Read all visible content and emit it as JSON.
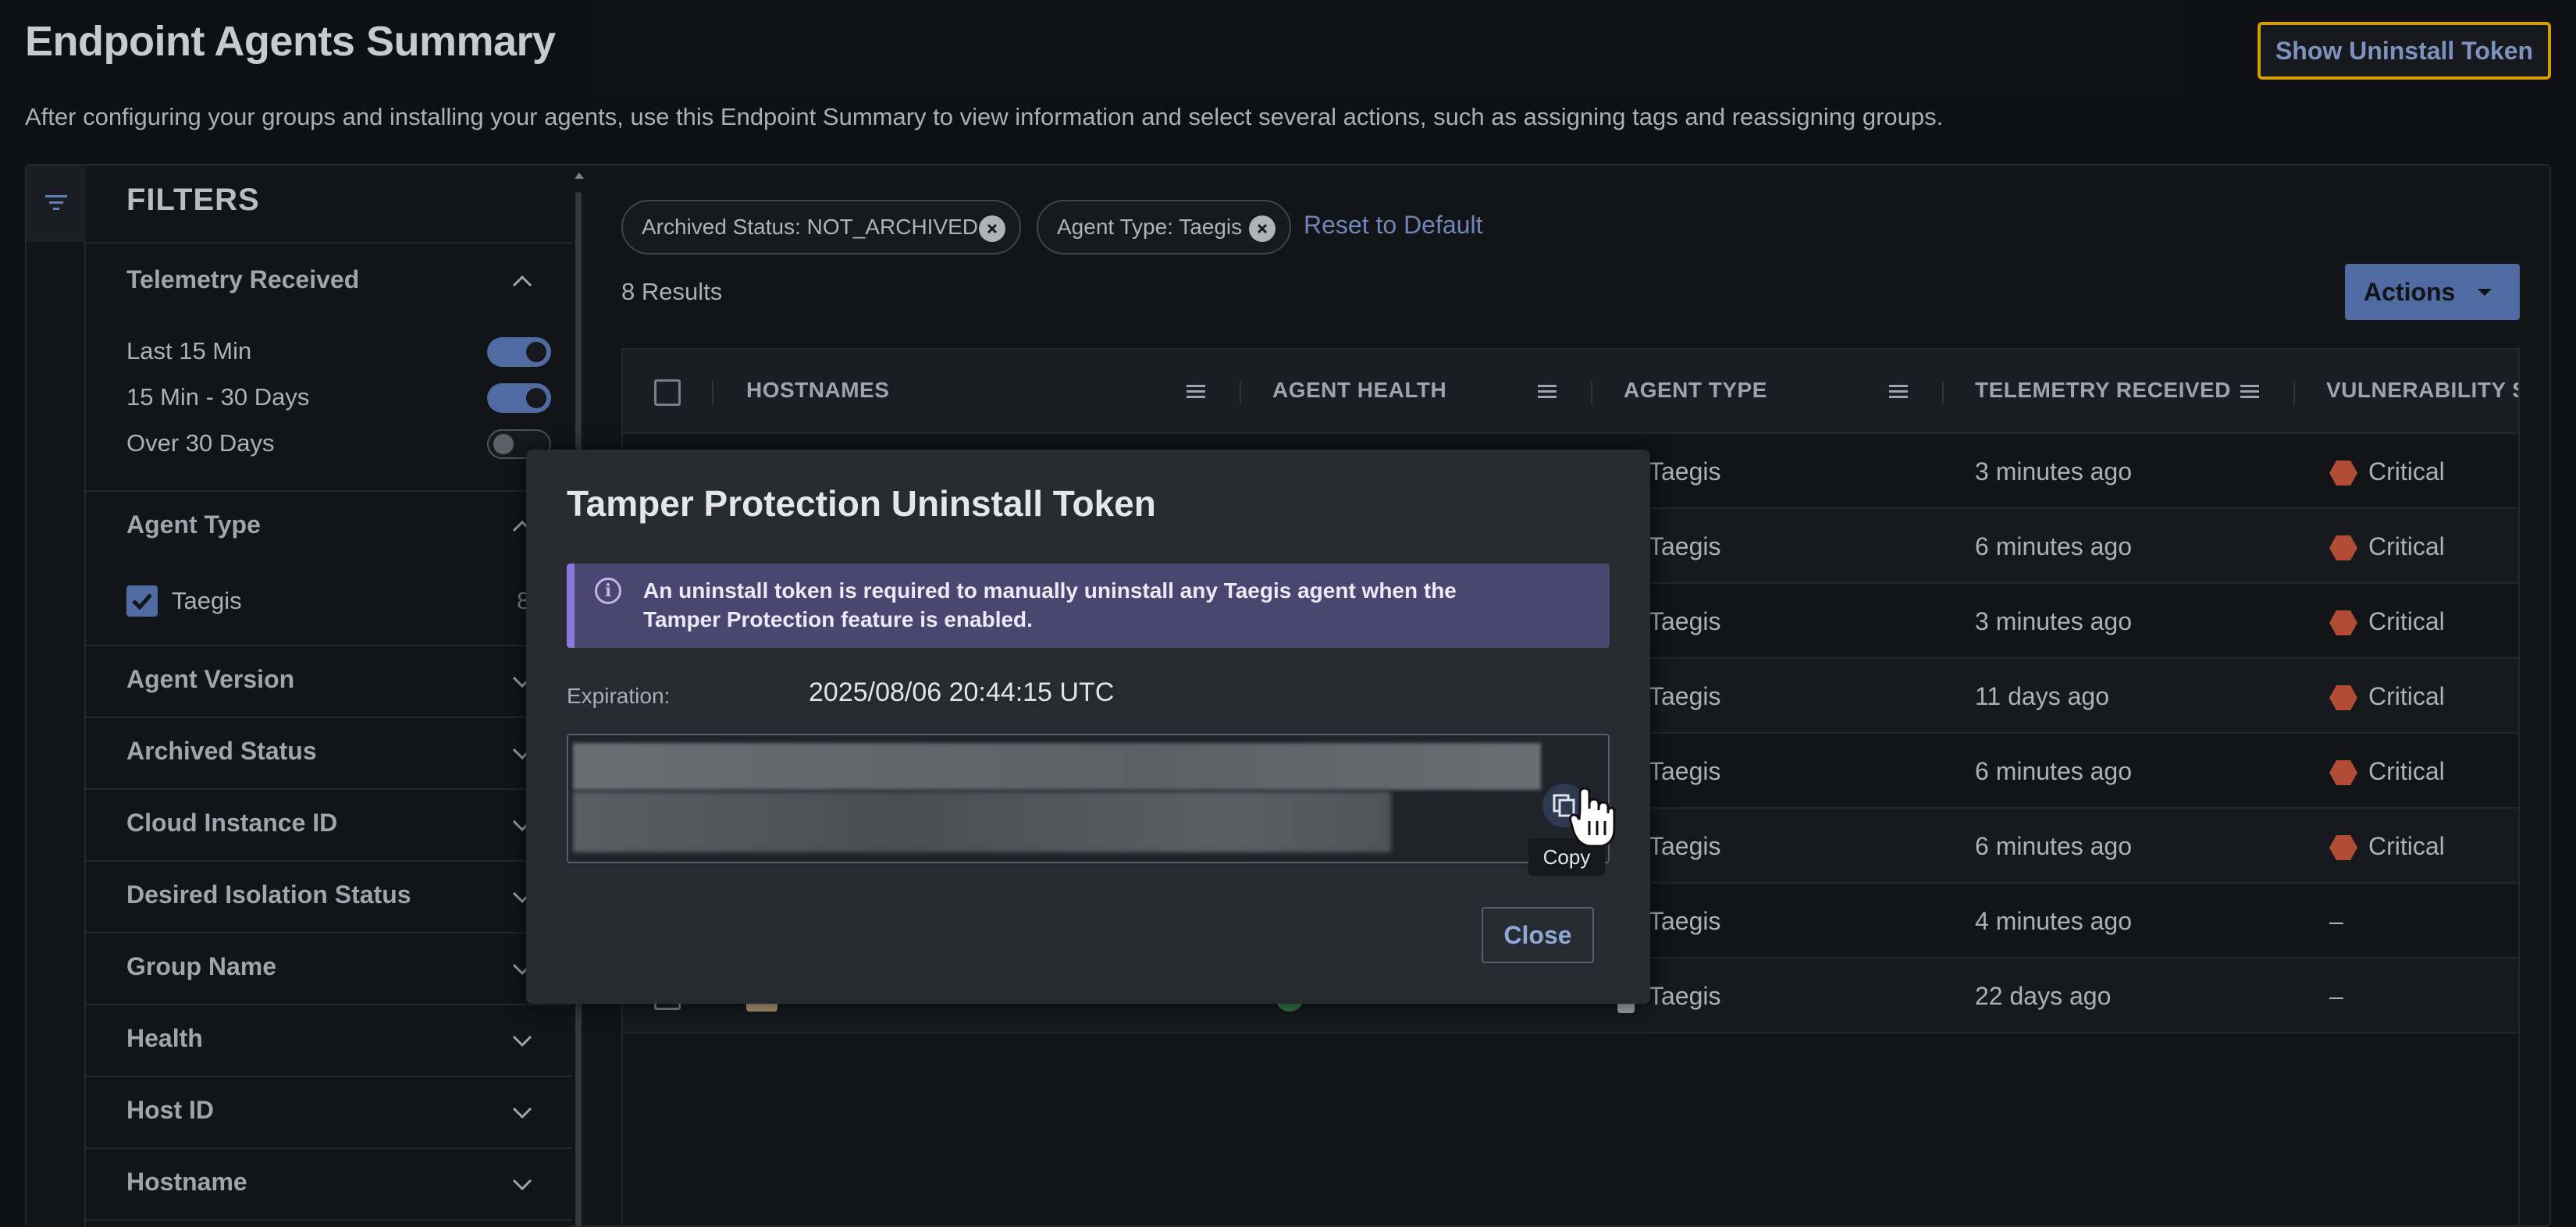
{
  "header": {
    "title": "Endpoint Agents Summary",
    "description": "After configuring your groups and installing your agents, use this Endpoint Summary to view information and select several actions, such as assigning tags and reassigning groups.",
    "uninstall_button": "Show Uninstall Token"
  },
  "filters": {
    "title": "FILTERS",
    "telemetry": {
      "label": "Telemetry Received",
      "options": [
        {
          "label": "Last 15 Min",
          "on": true
        },
        {
          "label": "15 Min - 30 Days",
          "on": true
        },
        {
          "label": "Over 30 Days",
          "on": false
        }
      ]
    },
    "agent_type": {
      "label": "Agent Type",
      "option": "Taegis",
      "count": "8"
    },
    "sections": [
      "Agent Version",
      "Archived Status",
      "Cloud Instance ID",
      "Desired Isolation Status",
      "Group Name",
      "Health",
      "Host ID",
      "Hostname"
    ]
  },
  "chips": [
    {
      "label": "Archived Status: NOT_ARCHIVED"
    },
    {
      "label": "Agent Type: Taegis"
    }
  ],
  "reset_label": "Reset to Default",
  "results_label": "8 Results",
  "actions_label": "Actions",
  "table": {
    "columns": [
      "HOSTNAMES",
      "AGENT HEALTH",
      "AGENT TYPE",
      "TELEMETRY RECEIVED",
      "VULNERABILITY ST"
    ],
    "rows": [
      {
        "agent_type": "Taegis",
        "telemetry": "3 minutes ago",
        "vulnerability": "Critical"
      },
      {
        "agent_type": "Taegis",
        "telemetry": "6 minutes ago",
        "vulnerability": "Critical"
      },
      {
        "agent_type": "Taegis",
        "telemetry": "3 minutes ago",
        "vulnerability": "Critical"
      },
      {
        "agent_type": "Taegis",
        "telemetry": "11 days ago",
        "vulnerability": "Critical"
      },
      {
        "agent_type": "Taegis",
        "telemetry": "6 minutes ago",
        "vulnerability": "Critical"
      },
      {
        "agent_type": "Taegis",
        "telemetry": "6 minutes ago",
        "vulnerability": "Critical"
      },
      {
        "agent_type": "Taegis",
        "telemetry": "4 minutes ago",
        "vulnerability": "–"
      },
      {
        "agent_type": "Taegis",
        "telemetry": "22 days ago",
        "vulnerability": "–"
      }
    ]
  },
  "modal": {
    "title": "Tamper Protection Uninstall Token",
    "notice": "An uninstall token is required to manually uninstall any Taegis agent when the Tamper Protection feature is enabled.",
    "expiration_label": "Expiration:",
    "expiration_value": "2025/08/06 20:44:15 UTC",
    "copy_tooltip": "Copy",
    "close_button": "Close"
  },
  "colors": {
    "accent": "#5b7ab8",
    "highlight_border": "#f0b400",
    "critical": "#c9583c",
    "notice_bg": "#4a4670"
  }
}
